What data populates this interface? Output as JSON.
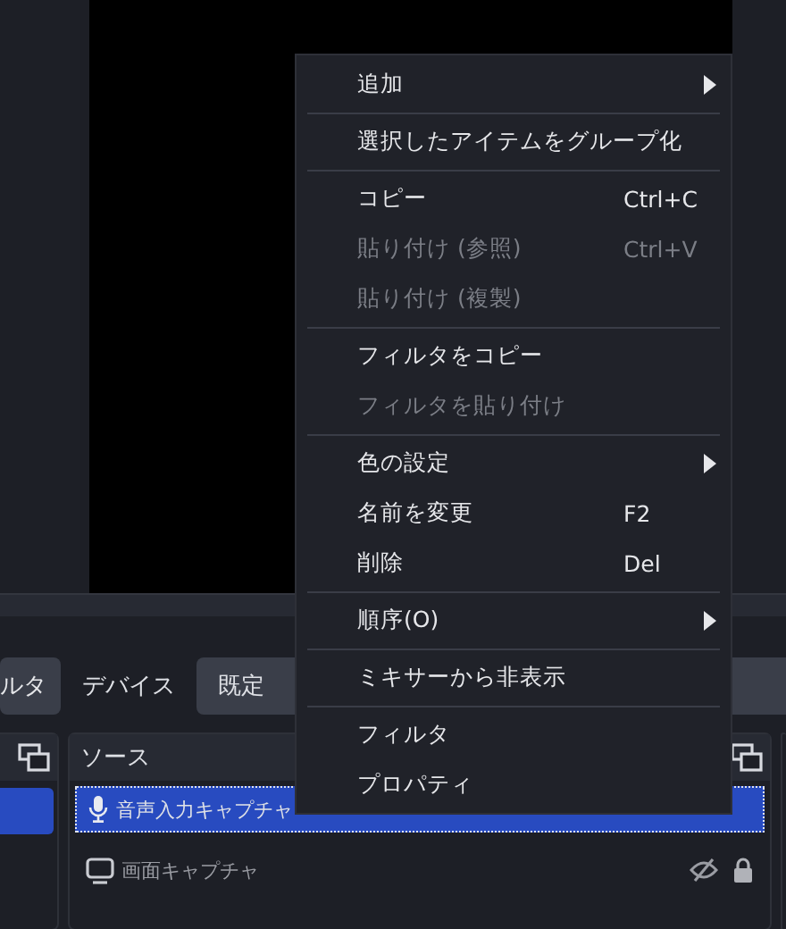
{
  "toolbar": {
    "filter_button": "ルタ",
    "device_label": "デバイス",
    "device_value": "既定"
  },
  "scenes": {
    "items": [
      {
        "selected": true
      }
    ]
  },
  "sources": {
    "title": "ソース",
    "items": [
      {
        "label": "音声入力キャプチャ",
        "kind": "audio",
        "selected": true
      },
      {
        "label": "画面キャプチャ",
        "kind": "display",
        "selected": false,
        "visible": false,
        "locked": true
      }
    ]
  },
  "context_menu": {
    "groups": [
      [
        {
          "label": "追加",
          "submenu": true,
          "disabled": false
        }
      ],
      [
        {
          "label": "選択したアイテムをグループ化",
          "submenu": false,
          "disabled": false
        }
      ],
      [
        {
          "label": "コピー",
          "shortcut": "Ctrl+C",
          "submenu": false,
          "disabled": false
        },
        {
          "label": "貼り付け (参照)",
          "shortcut": "Ctrl+V",
          "submenu": false,
          "disabled": true
        },
        {
          "label": "貼り付け (複製)",
          "submenu": false,
          "disabled": true
        }
      ],
      [
        {
          "label": "フィルタをコピー",
          "submenu": false,
          "disabled": false
        },
        {
          "label": "フィルタを貼り付け",
          "submenu": false,
          "disabled": true
        }
      ],
      [
        {
          "label": "色の設定",
          "submenu": true,
          "disabled": false
        },
        {
          "label": "名前を変更",
          "shortcut": "F2",
          "submenu": false,
          "disabled": false
        },
        {
          "label": "削除",
          "shortcut": "Del",
          "submenu": false,
          "disabled": false
        }
      ],
      [
        {
          "label": "順序(O)",
          "submenu": true,
          "disabled": false
        }
      ],
      [
        {
          "label": "ミキサーから非表示",
          "submenu": false,
          "disabled": false
        }
      ],
      [
        {
          "label": "フィルタ",
          "submenu": false,
          "disabled": false
        },
        {
          "label": "プロパティ",
          "submenu": false,
          "disabled": false
        }
      ]
    ]
  }
}
